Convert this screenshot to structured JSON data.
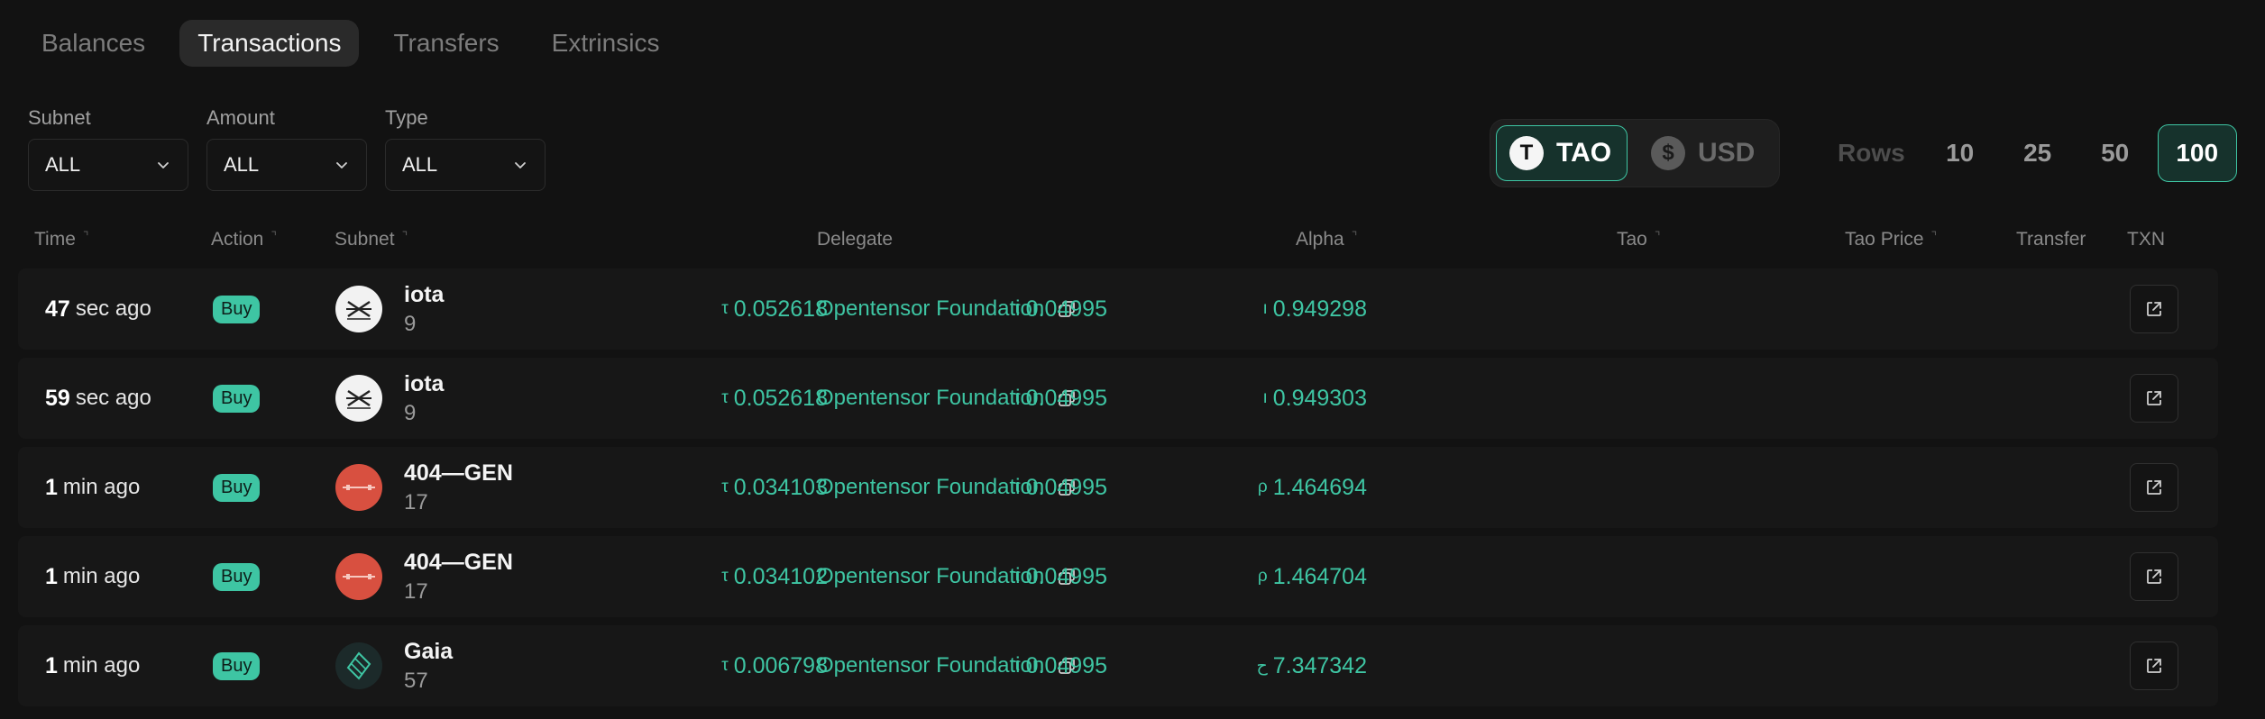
{
  "tabs": [
    "Balances",
    "Transactions",
    "Transfers",
    "Extrinsics"
  ],
  "filters": [
    {
      "label": "Subnet",
      "value": "ALL"
    },
    {
      "label": "Amount",
      "value": "ALL"
    },
    {
      "label": "Type",
      "value": "ALL"
    }
  ],
  "currency": {
    "tao": {
      "symbol": "T",
      "label": "TAO"
    },
    "usd": {
      "symbol": "$",
      "label": "USD"
    },
    "selected": "TAO"
  },
  "rows_selector": {
    "label": "Rows",
    "options": [
      "10",
      "25",
      "50",
      "100"
    ],
    "selected": "100"
  },
  "columns": {
    "time": "Time",
    "action": "Action",
    "subnet": "Subnet",
    "delegate": "Delegate",
    "alpha": "Alpha",
    "tao": "Tao",
    "tao_price": "Tao Price",
    "transfer": "Transfer",
    "txn": "TXN"
  },
  "transactions": [
    {
      "time_num": "47",
      "time_unit": "sec ago",
      "action": "Buy",
      "subnet_name": "iota",
      "subnet_num": "9",
      "delegate": "Opentensor Foundation",
      "alpha_sym": "ı",
      "alpha": "0.949298",
      "tao_sym": "τ",
      "tao": "0.04995",
      "price_sym": "τ",
      "tao_price": "0.052618"
    },
    {
      "time_num": "59",
      "time_unit": "sec ago",
      "action": "Buy",
      "subnet_name": "iota",
      "subnet_num": "9",
      "delegate": "Opentensor Foundation",
      "alpha_sym": "ı",
      "alpha": "0.949303",
      "tao_sym": "τ",
      "tao": "0.04995",
      "price_sym": "τ",
      "tao_price": "0.052618"
    },
    {
      "time_num": "1",
      "time_unit": "min ago",
      "action": "Buy",
      "subnet_name": "404—GEN",
      "subnet_num": "17",
      "delegate": "Opentensor Foundation",
      "alpha_sym": "ρ",
      "alpha": "1.464694",
      "tao_sym": "τ",
      "tao": "0.04995",
      "price_sym": "τ",
      "tao_price": "0.034103"
    },
    {
      "time_num": "1",
      "time_unit": "min ago",
      "action": "Buy",
      "subnet_name": "404—GEN",
      "subnet_num": "17",
      "delegate": "Opentensor Foundation",
      "alpha_sym": "ρ",
      "alpha": "1.464704",
      "tao_sym": "τ",
      "tao": "0.04995",
      "price_sym": "τ",
      "tao_price": "0.034102"
    },
    {
      "time_num": "1",
      "time_unit": "min ago",
      "action": "Buy",
      "subnet_name": "Gaia",
      "subnet_num": "57",
      "delegate": "Opentensor Foundation",
      "alpha_sym": "ح",
      "alpha": "7.347342",
      "tao_sym": "τ",
      "tao": "0.04995",
      "price_sym": "τ",
      "tao_price": "0.006798"
    }
  ],
  "colors": {
    "accent": "#3ec5a3",
    "background": "#121212",
    "row": "#171717"
  },
  "icons": {
    "copy": "copy-icon",
    "external": "external-link-icon",
    "dropdown": "chevron-down-icon"
  }
}
